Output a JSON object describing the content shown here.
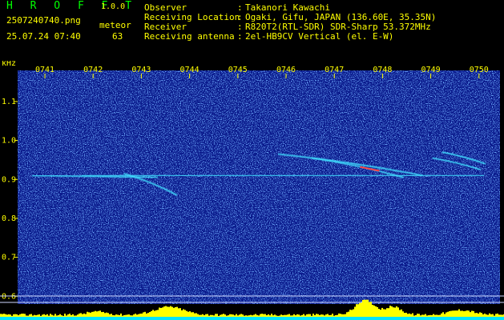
{
  "header": {
    "app_title": "H R O F F T",
    "app_version": "1.0.0",
    "filename": "2507240740.png",
    "event_type": "meteor",
    "datetime": "25.07.24 07:40",
    "count": "63",
    "info": [
      {
        "label": "Observer",
        "value": "Takanori Kawachi"
      },
      {
        "label": "Receiving Location",
        "value": "Ogaki, Gifu, JAPAN (136.60E, 35.35N)"
      },
      {
        "label": "Receiver",
        "value": "R820T2(RTL-SDR) SDR-Sharp 53.372MHz"
      },
      {
        "label": "Receiving antenna",
        "value": "2el-HB9CV Vertical (el. E-W)"
      }
    ],
    "separator": ":"
  },
  "chart_data": {
    "type": "heatmap",
    "xlabel": "",
    "ylabel": "kHz",
    "x_ticks": [
      "0741",
      "0742",
      "0743",
      "0744",
      "0745",
      "0746",
      "0747",
      "0748",
      "0749",
      "0750"
    ],
    "y_ticks": [
      1.1,
      1.0,
      0.9,
      0.8,
      0.7,
      0.6
    ],
    "ylim": [
      0.58,
      1.18
    ],
    "grid": false,
    "colors": {
      "background": "#0a1a8c",
      "noise": "#2f6cff",
      "signal": "#40e0ff",
      "strong": "#ff4040",
      "level_bar": "#ffff00",
      "baseline": "#00e5ff"
    },
    "carrier_khz": 0.91,
    "traces": [
      {
        "t": [
          0.3,
          2.9
        ],
        "f": [
          0.91,
          0.905
        ]
      },
      {
        "t": [
          2.2,
          3.3
        ],
        "f": [
          0.915,
          0.86
        ]
      },
      {
        "t": [
          5.4,
          8.4
        ],
        "f": [
          0.965,
          0.91
        ]
      },
      {
        "t": [
          6.1,
          8.0
        ],
        "f": [
          0.955,
          0.905
        ]
      },
      {
        "t": [
          8.6,
          9.6
        ],
        "f": [
          0.955,
          0.925
        ]
      },
      {
        "t": [
          8.8,
          9.7
        ],
        "f": [
          0.97,
          0.94
        ]
      }
    ]
  }
}
